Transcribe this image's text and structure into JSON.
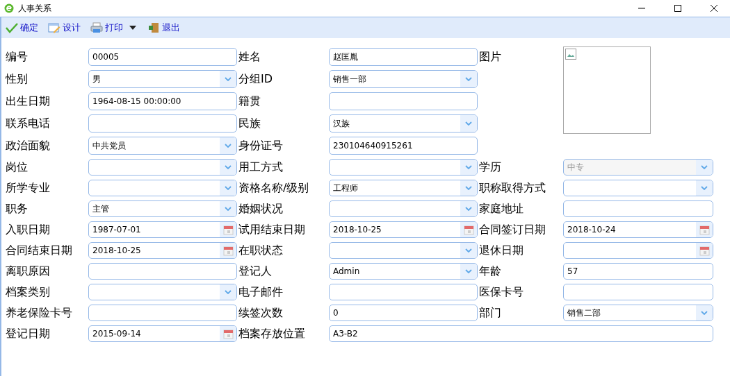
{
  "window": {
    "title": "人事关系"
  },
  "toolbar": [
    {
      "label": "确定",
      "kind": "check"
    },
    {
      "label": "设计",
      "kind": "design"
    },
    {
      "label": "打印",
      "kind": "print",
      "dropdown": true
    },
    {
      "label": "退出",
      "kind": "exit"
    }
  ],
  "rows": [
    [
      {
        "label": "编号",
        "kind": "text",
        "value": "00005"
      },
      {
        "label": "姓名",
        "kind": "text",
        "value": "赵匡胤"
      },
      {
        "label": "图片",
        "kind": "image"
      }
    ],
    [
      {
        "label": "性别",
        "kind": "select",
        "value": "男"
      },
      {
        "label": "分组ID",
        "kind": "select",
        "value": "销售一部"
      }
    ],
    [
      {
        "label": "出生日期",
        "kind": "text",
        "value": "1964-08-15 00:00:00"
      },
      {
        "label": "籍贯",
        "kind": "text"
      }
    ],
    [
      {
        "label": "联系电话",
        "kind": "text"
      },
      {
        "label": "民族",
        "kind": "select",
        "value": "汉族"
      }
    ],
    [
      {
        "label": "政治面貌",
        "kind": "select",
        "value": "中共党员"
      },
      {
        "label": "身份证号",
        "kind": "text",
        "value": "230104640915261"
      }
    ],
    [
      {
        "label": "岗位",
        "kind": "select"
      },
      {
        "label": "用工方式",
        "kind": "select"
      },
      {
        "label": "学历",
        "kind": "select",
        "value": "中专",
        "disabled": true
      }
    ],
    [
      {
        "label": "所学专业",
        "kind": "select"
      },
      {
        "label": "资格名称/级别",
        "kind": "select",
        "value": "工程师"
      },
      {
        "label": "职称取得方式",
        "kind": "select"
      }
    ],
    [
      {
        "label": "职务",
        "kind": "select",
        "value": "主管"
      },
      {
        "label": "婚姻状况",
        "kind": "select"
      },
      {
        "label": "家庭地址",
        "kind": "text"
      }
    ],
    [
      {
        "label": "入职日期",
        "kind": "date",
        "value": "1987-07-01"
      },
      {
        "label": "试用结束日期",
        "kind": "date",
        "value": "2018-10-25"
      },
      {
        "label": "合同签订日期",
        "kind": "date",
        "value": "2018-10-24"
      }
    ],
    [
      {
        "label": "合同结束日期",
        "kind": "date",
        "value": "2018-10-25"
      },
      {
        "label": "在职状态",
        "kind": "select"
      },
      {
        "label": "退休日期",
        "kind": "date"
      }
    ],
    [
      {
        "label": "离职原因",
        "kind": "text"
      },
      {
        "label": "登记人",
        "kind": "select",
        "value": "Admin"
      },
      {
        "label": "年龄",
        "kind": "text",
        "value": "57"
      }
    ],
    [
      {
        "label": "档案类别",
        "kind": "select"
      },
      {
        "label": "电子邮件",
        "kind": "text"
      },
      {
        "label": "医保卡号",
        "kind": "text"
      }
    ],
    [
      {
        "label": "养老保险卡号",
        "kind": "text"
      },
      {
        "label": "续签次数",
        "kind": "text",
        "value": "0"
      },
      {
        "label": "部门",
        "kind": "select",
        "value": "销售二部"
      }
    ],
    [
      {
        "label": "登记日期",
        "kind": "date",
        "value": "2015-09-14"
      },
      {
        "label": "档案存放位置",
        "kind": "wide_text",
        "value": "A3-B2"
      }
    ]
  ]
}
